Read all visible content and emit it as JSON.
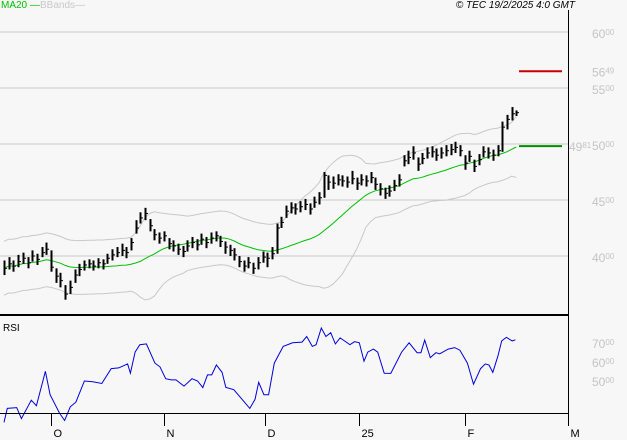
{
  "header": {
    "ma_legend": "MA20",
    "bbands_legend": "BBands",
    "copyright": "© TEC 19/2/2025 4:0 GMT"
  },
  "colors": {
    "ma": "#00c000",
    "bbands": "#c8c8c8",
    "bars": "#000000",
    "rsi": "#0000dd",
    "resistance": "#cc0000",
    "support": "#009000",
    "grid": "#c8c8c8"
  },
  "chart_data": [
    {
      "type": "ohlc",
      "title": "Price",
      "ylim": [
        33.5,
        61.5
      ],
      "y_ticks": [
        {
          "value": 60,
          "int": "60",
          "dec": "00"
        },
        {
          "value": 55,
          "int": "55",
          "dec": "00"
        },
        {
          "value": 50,
          "int": "50",
          "dec": "00"
        },
        {
          "value": 45,
          "int": "45",
          "dec": "00"
        },
        {
          "value": 40,
          "int": "40",
          "dec": "00"
        }
      ],
      "x_ticks": [
        {
          "bar": 10,
          "label": "O"
        },
        {
          "bar": 34,
          "label": "N"
        },
        {
          "bar": 55.5,
          "label": "D"
        },
        {
          "bar": 75.5,
          "label": "25"
        },
        {
          "bar": 98,
          "label": "F"
        },
        {
          "bar": 120,
          "label": "M"
        }
      ],
      "bars_hlc": [
        [
          39.6,
          38.3,
          38.9
        ],
        [
          39.9,
          38.8,
          39.3
        ],
        [
          39.6,
          38.6,
          39.1
        ],
        [
          40.1,
          39.0,
          39.5
        ],
        [
          40.3,
          39.3,
          39.8
        ],
        [
          39.9,
          38.9,
          39.4
        ],
        [
          40.5,
          39.5,
          40.0
        ],
        [
          40.2,
          39.2,
          39.7
        ],
        [
          40.8,
          39.9,
          40.3
        ],
        [
          41.2,
          40.1,
          40.6
        ],
        [
          40.5,
          38.6,
          39.0
        ],
        [
          38.9,
          37.6,
          38.2
        ],
        [
          38.5,
          37.2,
          37.8
        ],
        [
          37.4,
          36.1,
          36.6
        ],
        [
          37.8,
          36.6,
          37.2
        ],
        [
          38.8,
          37.6,
          38.3
        ],
        [
          39.3,
          38.2,
          38.8
        ],
        [
          39.6,
          38.7,
          39.2
        ],
        [
          39.7,
          38.9,
          39.3
        ],
        [
          39.6,
          38.7,
          39.1
        ],
        [
          39.8,
          38.9,
          39.4
        ],
        [
          39.7,
          38.8,
          39.3
        ],
        [
          40.2,
          39.3,
          39.8
        ],
        [
          40.6,
          39.6,
          40.1
        ],
        [
          40.8,
          39.9,
          40.3
        ],
        [
          41.1,
          40.0,
          40.5
        ],
        [
          40.8,
          39.8,
          40.3
        ],
        [
          41.6,
          40.5,
          41.2
        ],
        [
          43.2,
          42.0,
          42.5
        ],
        [
          43.9,
          42.9,
          43.4
        ],
        [
          44.3,
          43.2,
          43.8
        ],
        [
          43.3,
          42.2,
          42.7
        ],
        [
          42.4,
          41.4,
          41.9
        ],
        [
          42.1,
          41.1,
          41.6
        ],
        [
          42.2,
          41.3,
          41.8
        ],
        [
          41.6,
          40.6,
          41.1
        ],
        [
          41.4,
          40.4,
          40.9
        ],
        [
          41.1,
          40.1,
          40.6
        ],
        [
          40.9,
          39.9,
          40.4
        ],
        [
          41.4,
          40.4,
          40.9
        ],
        [
          41.7,
          40.7,
          41.2
        ],
        [
          41.5,
          40.5,
          41.0
        ],
        [
          42.0,
          41.0,
          41.5
        ],
        [
          41.7,
          40.7,
          41.2
        ],
        [
          42.1,
          41.1,
          41.6
        ],
        [
          42.2,
          41.3,
          41.8
        ],
        [
          41.8,
          40.8,
          41.3
        ],
        [
          41.3,
          40.2,
          40.8
        ],
        [
          41.0,
          40.0,
          40.5
        ],
        [
          40.7,
          39.6,
          40.1
        ],
        [
          40.0,
          39.0,
          39.5
        ],
        [
          39.6,
          38.6,
          39.1
        ],
        [
          39.9,
          38.9,
          39.4
        ],
        [
          39.4,
          38.4,
          38.9
        ],
        [
          39.9,
          38.8,
          39.4
        ],
        [
          40.4,
          39.4,
          39.9
        ],
        [
          40.3,
          39.0,
          39.8
        ],
        [
          40.8,
          39.7,
          40.2
        ],
        [
          42.9,
          40.2,
          42.5
        ],
        [
          43.5,
          42.5,
          43.0
        ],
        [
          44.5,
          43.4,
          44.0
        ],
        [
          44.8,
          43.8,
          44.3
        ],
        [
          44.7,
          43.7,
          44.2
        ],
        [
          44.9,
          43.9,
          44.4
        ],
        [
          45.1,
          44.1,
          44.6
        ],
        [
          44.7,
          43.7,
          44.2
        ],
        [
          45.3,
          44.3,
          44.8
        ],
        [
          45.7,
          44.6,
          45.2
        ],
        [
          47.5,
          45.2,
          47.2
        ],
        [
          47.2,
          45.9,
          46.6
        ],
        [
          47.1,
          46.0,
          46.5
        ],
        [
          47.3,
          46.3,
          46.8
        ],
        [
          47.2,
          46.2,
          46.7
        ],
        [
          47.1,
          46.1,
          46.6
        ],
        [
          47.6,
          46.4,
          46.9
        ],
        [
          47.0,
          45.9,
          46.5
        ],
        [
          47.3,
          46.3,
          46.8
        ],
        [
          47.2,
          46.2,
          46.7
        ],
        [
          47.5,
          46.5,
          47.0
        ],
        [
          47.0,
          45.9,
          46.4
        ],
        [
          46.5,
          45.4,
          46.0
        ],
        [
          46.1,
          45.1,
          45.6
        ],
        [
          46.3,
          45.3,
          45.8
        ],
        [
          46.8,
          45.8,
          46.3
        ],
        [
          47.3,
          46.2,
          46.8
        ],
        [
          49.0,
          48.0,
          48.5
        ],
        [
          49.4,
          48.2,
          48.8
        ],
        [
          49.8,
          48.6,
          49.2
        ],
        [
          48.8,
          47.6,
          48.2
        ],
        [
          49.2,
          48.2,
          48.7
        ],
        [
          49.7,
          48.7,
          49.2
        ],
        [
          49.8,
          48.8,
          49.3
        ],
        [
          49.6,
          48.5,
          49.0
        ],
        [
          49.7,
          48.7,
          49.2
        ],
        [
          49.9,
          48.9,
          49.4
        ],
        [
          50.0,
          49.0,
          49.5
        ],
        [
          50.2,
          49.2,
          49.7
        ],
        [
          49.9,
          48.9,
          49.4
        ],
        [
          49.0,
          47.7,
          48.3
        ],
        [
          49.4,
          48.4,
          48.9
        ],
        [
          48.6,
          47.5,
          48.0
        ],
        [
          49.1,
          48.1,
          48.6
        ],
        [
          49.8,
          48.8,
          49.3
        ],
        [
          49.7,
          48.7,
          49.2
        ],
        [
          49.5,
          48.5,
          49.0
        ],
        [
          49.9,
          48.9,
          49.4
        ],
        [
          52.0,
          49.3,
          51.5
        ],
        [
          52.6,
          51.3,
          52.2
        ],
        [
          53.3,
          52.1,
          52.7
        ],
        [
          53.0,
          52.5,
          52.8
        ]
      ],
      "overlays": [
        "MA20",
        "BBands"
      ],
      "annotations": [
        {
          "label": "56.49",
          "value": 56.49,
          "int": "56",
          "dec": "49",
          "color": "#cc0000"
        },
        {
          "label": "49.81",
          "value": 49.81,
          "int": "49",
          "dec": "81",
          "color": "#009000"
        }
      ]
    },
    {
      "type": "line",
      "title": "RSI",
      "ylim": [
        26,
        81
      ],
      "y_ticks": [
        {
          "value": 70,
          "int": "70",
          "dec": "00"
        },
        {
          "value": 60,
          "int": "60",
          "dec": "00"
        },
        {
          "value": 50,
          "int": "50",
          "dec": "00"
        }
      ],
      "points_bar_value": [
        [
          0,
          28.2
        ],
        [
          0.7,
          35.6
        ],
        [
          2.7,
          36.0
        ],
        [
          3.7,
          30.2
        ],
        [
          5.8,
          39.9
        ],
        [
          6.9,
          37.0
        ],
        [
          8.8,
          55.1
        ],
        [
          9.8,
          42.8
        ],
        [
          11.8,
          33.1
        ],
        [
          12.9,
          29.2
        ],
        [
          14.1,
          36.4
        ],
        [
          15.3,
          38.9
        ],
        [
          17.1,
          50.0
        ],
        [
          18.9,
          49.6
        ],
        [
          20.8,
          48.7
        ],
        [
          22.8,
          56.5
        ],
        [
          24.4,
          56.9
        ],
        [
          26.3,
          59.0
        ],
        [
          26.9,
          54.1
        ],
        [
          27.9,
          65.2
        ],
        [
          28.9,
          69.1
        ],
        [
          30.3,
          69.5
        ],
        [
          32.1,
          59.4
        ],
        [
          33.2,
          57.4
        ],
        [
          34.4,
          51.2
        ],
        [
          35.6,
          50.6
        ],
        [
          36.6,
          50.6
        ],
        [
          38.3,
          47.3
        ],
        [
          40.0,
          51.2
        ],
        [
          41.2,
          50.0
        ],
        [
          42.3,
          46.5
        ],
        [
          43.3,
          53.2
        ],
        [
          44.2,
          53.2
        ],
        [
          45.2,
          58.4
        ],
        [
          46.4,
          54.5
        ],
        [
          47.2,
          46.7
        ],
        [
          48.9,
          45.4
        ],
        [
          50.8,
          39.9
        ],
        [
          52.3,
          35.6
        ],
        [
          53.4,
          40.3
        ],
        [
          54.2,
          49.3
        ],
        [
          55.3,
          42.8
        ],
        [
          56.3,
          42.8
        ],
        [
          57.5,
          59.4
        ],
        [
          59.4,
          68.2
        ],
        [
          61.4,
          70.1
        ],
        [
          63.4,
          70.5
        ],
        [
          64.4,
          73.4
        ],
        [
          65.6,
          68.2
        ],
        [
          66.4,
          69.1
        ],
        [
          67.5,
          77.9
        ],
        [
          68.5,
          73.4
        ],
        [
          69.5,
          75.4
        ],
        [
          70.5,
          69.5
        ],
        [
          71.5,
          72.7
        ],
        [
          73.6,
          69.1
        ],
        [
          74.6,
          70.7
        ],
        [
          75.6,
          70.1
        ],
        [
          76.6,
          60.4
        ],
        [
          77.4,
          65.2
        ],
        [
          78.6,
          66.8
        ],
        [
          79.5,
          65.2
        ],
        [
          80.9,
          54.1
        ],
        [
          82.3,
          54.0
        ],
        [
          84.6,
          65.2
        ],
        [
          86.2,
          70.1
        ],
        [
          87.9,
          64.9
        ],
        [
          88.7,
          64.9
        ],
        [
          89.5,
          71.5
        ],
        [
          90.7,
          62.3
        ],
        [
          91.9,
          64.9
        ],
        [
          92.7,
          64.3
        ],
        [
          94.5,
          66.8
        ],
        [
          95.9,
          67.6
        ],
        [
          97.0,
          66.2
        ],
        [
          98.6,
          59.4
        ],
        [
          99.9,
          48.3
        ],
        [
          101.4,
          56.5
        ],
        [
          102.4,
          59.0
        ],
        [
          103.2,
          58.4
        ],
        [
          104.0,
          54.5
        ],
        [
          105.1,
          63.3
        ],
        [
          105.9,
          71.1
        ],
        [
          106.9,
          73.0
        ],
        [
          108.1,
          71.1
        ],
        [
          108.8,
          71.7
        ]
      ]
    }
  ]
}
